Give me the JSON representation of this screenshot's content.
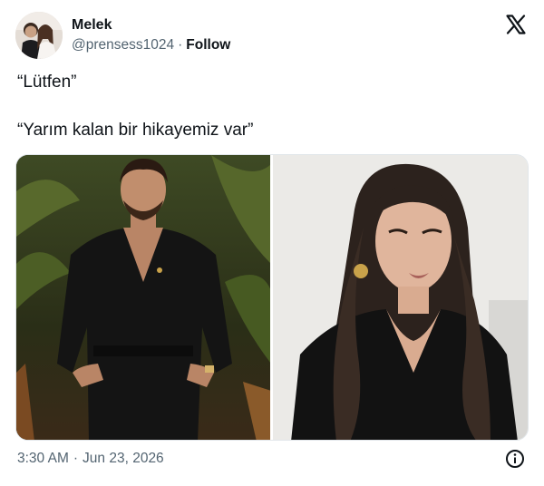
{
  "tweet": {
    "author_name": "Melek",
    "handle": "@prensess1024",
    "separator": "·",
    "follow_label": "Follow",
    "lines": [
      "“Lütfen”",
      "“Yarım kalan bir hikayemiz var”"
    ],
    "time": "3:30 AM",
    "date": "Jun 23, 2026"
  },
  "icons": {
    "logo": "x-logo-icon",
    "info": "info-icon"
  },
  "colors": {
    "text_primary": "#0f1419",
    "text_secondary": "#536471",
    "border": "#e1e6ea"
  }
}
